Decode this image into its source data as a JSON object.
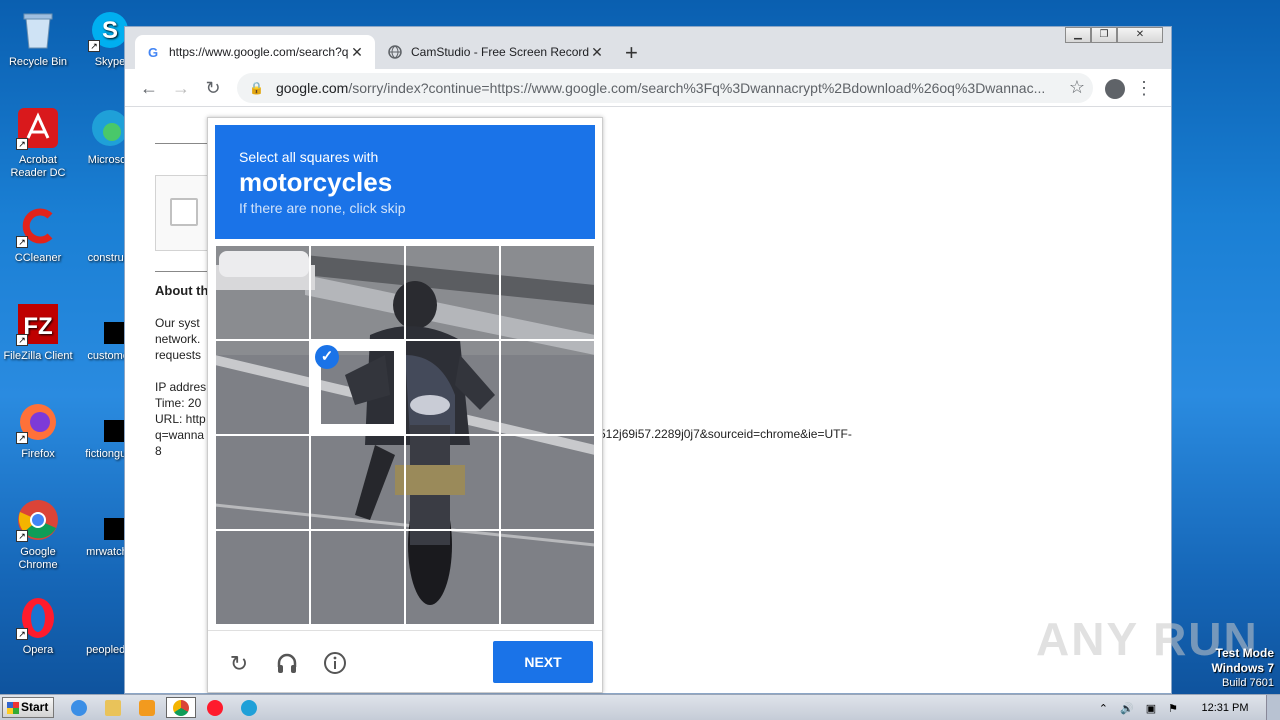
{
  "desktop": {
    "icons": [
      {
        "label": "Recycle Bin"
      },
      {
        "label": "Skype"
      },
      {
        "label": "Acrobat Reader DC"
      },
      {
        "label": "Microsoft"
      },
      {
        "label": "CCleaner"
      },
      {
        "label": "construct"
      },
      {
        "label": "FileZilla Client"
      },
      {
        "label": "customer"
      },
      {
        "label": "Firefox"
      },
      {
        "label": "fictionguid"
      },
      {
        "label": "Google Chrome"
      },
      {
        "label": "mrwatche"
      },
      {
        "label": "Opera"
      },
      {
        "label": "peopledid"
      }
    ]
  },
  "browser": {
    "tabs": [
      {
        "title": "https://www.google.com/search?q=",
        "icon": "google-g-icon",
        "close": "✕"
      },
      {
        "title": "CamStudio - Free Screen Recording",
        "icon": "globe-icon",
        "close": "✕"
      }
    ],
    "new_tab": "+",
    "url_host": "google.com",
    "url_rest": "/sorry/index?continue=https://www.google.com/search%3Fq%3Dwannacrypt%2Bdownload%26oq%3Dwannac..."
  },
  "page": {
    "about_heading": "About th",
    "para_lines": [
      "Our syst",
      "network.",
      "requests"
    ],
    "ip_lines": [
      "IP addres",
      "Time: 20",
      "URL: http",
      "q=wanna",
      "8"
    ],
    "url_tail": "512j69i57.2289j0j7&sourceid=chrome&ie=UTF-"
  },
  "captcha": {
    "line1": "Select all squares with",
    "target": "motorcycles",
    "line3": "If there are none, click skip",
    "next_label": "NEXT",
    "selected_tile_index": 5
  },
  "watermark": "ANY RUN",
  "os": {
    "test_mode": "Test Mode",
    "os_name": "Windows 7",
    "build": "Build 7601",
    "start_label": "Start",
    "clock": "12:31 PM"
  }
}
